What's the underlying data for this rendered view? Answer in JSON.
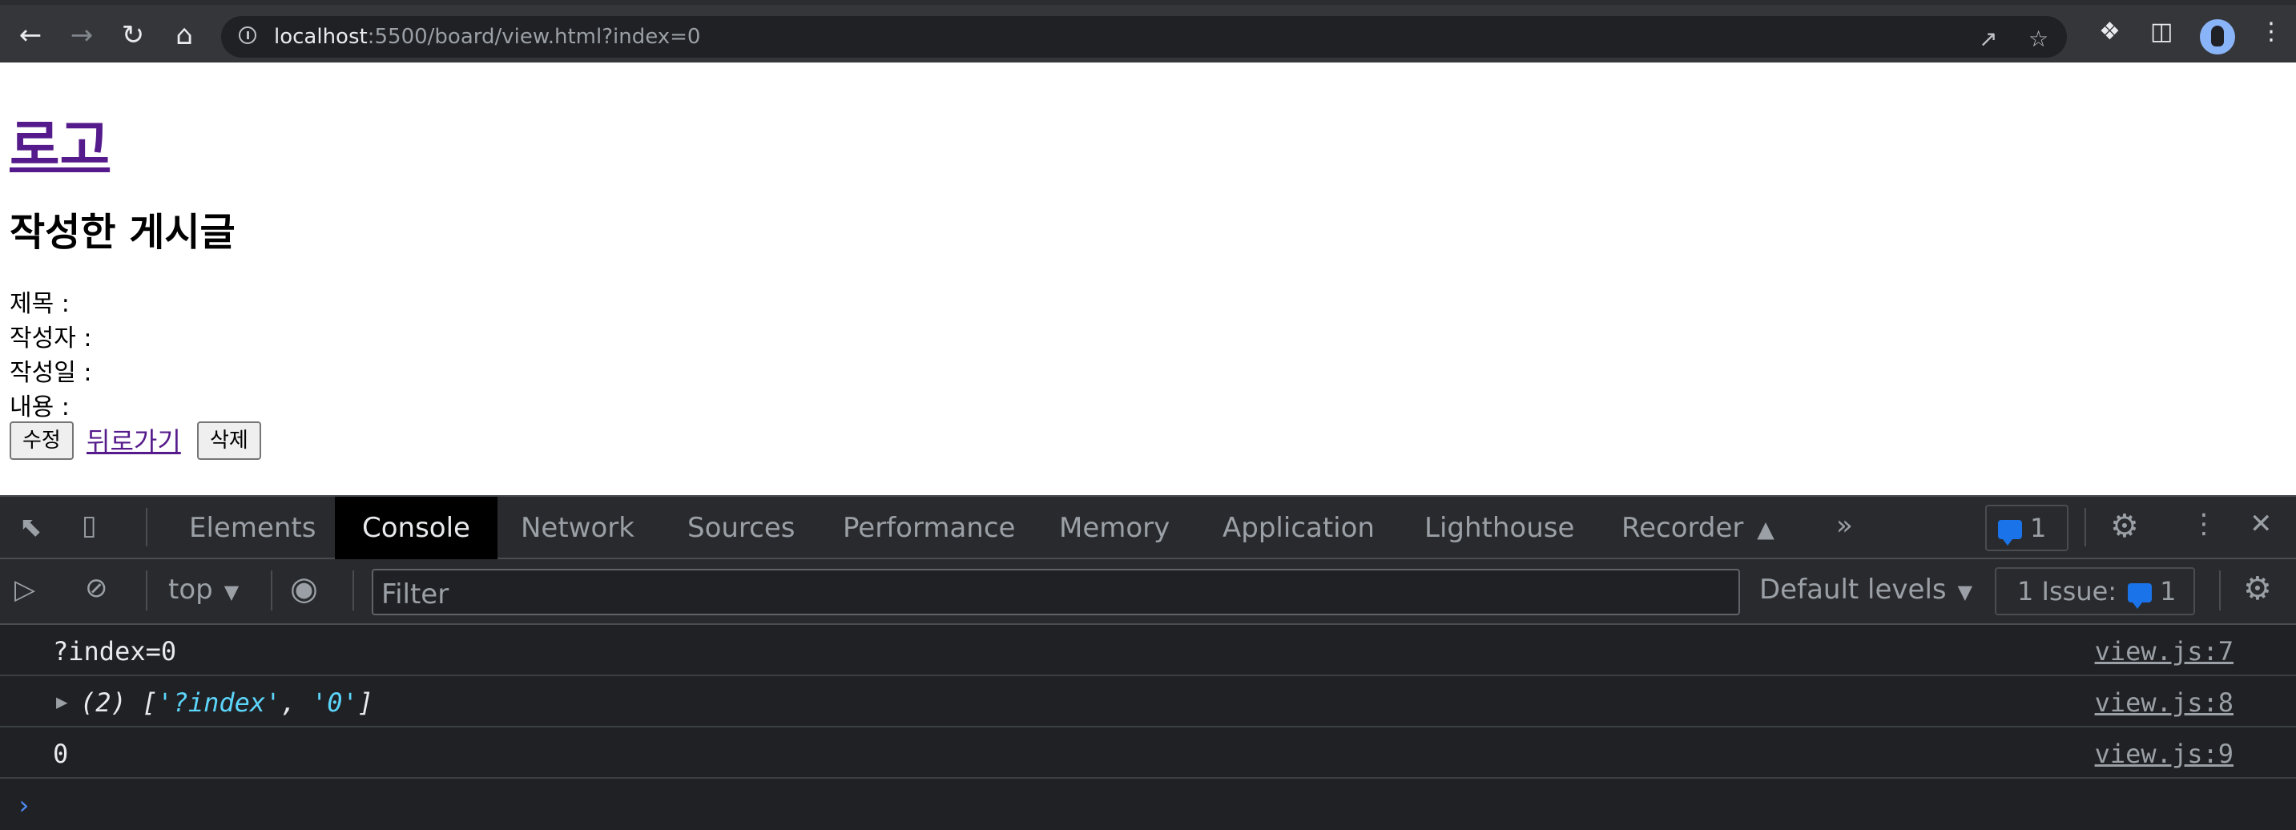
{
  "browser": {
    "url_host": "localhost",
    "url_rest": ":5500/board/view.html?index=0"
  },
  "page": {
    "logo": "로고",
    "heading": "작성한 게시글",
    "fields": [
      "제목 :",
      "작성자 :",
      "작성일 :",
      "내용 :"
    ],
    "edit_button": "수정",
    "back_link": "뒤로가기",
    "delete_button": "삭제"
  },
  "devtools": {
    "tabs": [
      "Elements",
      "Console",
      "Network",
      "Sources",
      "Performance",
      "Memory",
      "Application",
      "Lighthouse",
      "Recorder"
    ],
    "active_tab": "Console",
    "messages_count": "1",
    "context": "top",
    "filter_placeholder": "Filter",
    "levels": "Default levels",
    "issues_label": "1 Issue:",
    "issues_count": "1",
    "accent": "#1a73e8"
  },
  "console": {
    "rows": [
      {
        "message": "?index=0",
        "source": "view.js:7"
      },
      {
        "count": "(2)",
        "open": "[",
        "str1": "'?index'",
        "comma": ",",
        "str2": "'0'",
        "close": "]",
        "source": "view.js:8"
      },
      {
        "message": "0",
        "source": "view.js:9"
      }
    ]
  }
}
